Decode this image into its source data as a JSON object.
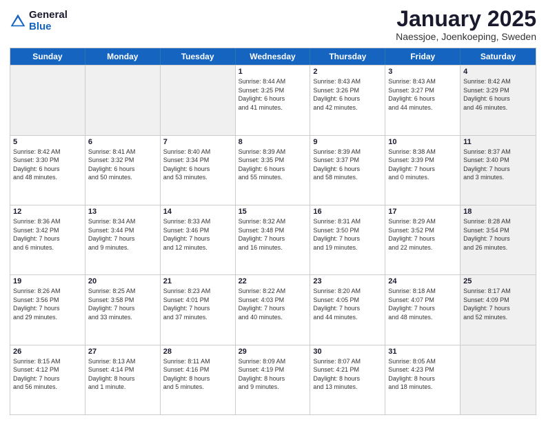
{
  "logo": {
    "general": "General",
    "blue": "Blue"
  },
  "title": "January 2025",
  "location": "Naessjoe, Joenkoeping, Sweden",
  "header_days": [
    "Sunday",
    "Monday",
    "Tuesday",
    "Wednesday",
    "Thursday",
    "Friday",
    "Saturday"
  ],
  "weeks": [
    [
      {
        "day": "",
        "info": "",
        "shaded": true
      },
      {
        "day": "",
        "info": "",
        "shaded": true
      },
      {
        "day": "",
        "info": "",
        "shaded": true
      },
      {
        "day": "1",
        "info": "Sunrise: 8:44 AM\nSunset: 3:25 PM\nDaylight: 6 hours\nand 41 minutes."
      },
      {
        "day": "2",
        "info": "Sunrise: 8:43 AM\nSunset: 3:26 PM\nDaylight: 6 hours\nand 42 minutes."
      },
      {
        "day": "3",
        "info": "Sunrise: 8:43 AM\nSunset: 3:27 PM\nDaylight: 6 hours\nand 44 minutes."
      },
      {
        "day": "4",
        "info": "Sunrise: 8:42 AM\nSunset: 3:29 PM\nDaylight: 6 hours\nand 46 minutes.",
        "shaded": true
      }
    ],
    [
      {
        "day": "5",
        "info": "Sunrise: 8:42 AM\nSunset: 3:30 PM\nDaylight: 6 hours\nand 48 minutes."
      },
      {
        "day": "6",
        "info": "Sunrise: 8:41 AM\nSunset: 3:32 PM\nDaylight: 6 hours\nand 50 minutes."
      },
      {
        "day": "7",
        "info": "Sunrise: 8:40 AM\nSunset: 3:34 PM\nDaylight: 6 hours\nand 53 minutes."
      },
      {
        "day": "8",
        "info": "Sunrise: 8:39 AM\nSunset: 3:35 PM\nDaylight: 6 hours\nand 55 minutes."
      },
      {
        "day": "9",
        "info": "Sunrise: 8:39 AM\nSunset: 3:37 PM\nDaylight: 6 hours\nand 58 minutes."
      },
      {
        "day": "10",
        "info": "Sunrise: 8:38 AM\nSunset: 3:39 PM\nDaylight: 7 hours\nand 0 minutes."
      },
      {
        "day": "11",
        "info": "Sunrise: 8:37 AM\nSunset: 3:40 PM\nDaylight: 7 hours\nand 3 minutes.",
        "shaded": true
      }
    ],
    [
      {
        "day": "12",
        "info": "Sunrise: 8:36 AM\nSunset: 3:42 PM\nDaylight: 7 hours\nand 6 minutes."
      },
      {
        "day": "13",
        "info": "Sunrise: 8:34 AM\nSunset: 3:44 PM\nDaylight: 7 hours\nand 9 minutes."
      },
      {
        "day": "14",
        "info": "Sunrise: 8:33 AM\nSunset: 3:46 PM\nDaylight: 7 hours\nand 12 minutes."
      },
      {
        "day": "15",
        "info": "Sunrise: 8:32 AM\nSunset: 3:48 PM\nDaylight: 7 hours\nand 16 minutes."
      },
      {
        "day": "16",
        "info": "Sunrise: 8:31 AM\nSunset: 3:50 PM\nDaylight: 7 hours\nand 19 minutes."
      },
      {
        "day": "17",
        "info": "Sunrise: 8:29 AM\nSunset: 3:52 PM\nDaylight: 7 hours\nand 22 minutes."
      },
      {
        "day": "18",
        "info": "Sunrise: 8:28 AM\nSunset: 3:54 PM\nDaylight: 7 hours\nand 26 minutes.",
        "shaded": true
      }
    ],
    [
      {
        "day": "19",
        "info": "Sunrise: 8:26 AM\nSunset: 3:56 PM\nDaylight: 7 hours\nand 29 minutes."
      },
      {
        "day": "20",
        "info": "Sunrise: 8:25 AM\nSunset: 3:58 PM\nDaylight: 7 hours\nand 33 minutes."
      },
      {
        "day": "21",
        "info": "Sunrise: 8:23 AM\nSunset: 4:01 PM\nDaylight: 7 hours\nand 37 minutes."
      },
      {
        "day": "22",
        "info": "Sunrise: 8:22 AM\nSunset: 4:03 PM\nDaylight: 7 hours\nand 40 minutes."
      },
      {
        "day": "23",
        "info": "Sunrise: 8:20 AM\nSunset: 4:05 PM\nDaylight: 7 hours\nand 44 minutes."
      },
      {
        "day": "24",
        "info": "Sunrise: 8:18 AM\nSunset: 4:07 PM\nDaylight: 7 hours\nand 48 minutes."
      },
      {
        "day": "25",
        "info": "Sunrise: 8:17 AM\nSunset: 4:09 PM\nDaylight: 7 hours\nand 52 minutes.",
        "shaded": true
      }
    ],
    [
      {
        "day": "26",
        "info": "Sunrise: 8:15 AM\nSunset: 4:12 PM\nDaylight: 7 hours\nand 56 minutes."
      },
      {
        "day": "27",
        "info": "Sunrise: 8:13 AM\nSunset: 4:14 PM\nDaylight: 8 hours\nand 1 minute."
      },
      {
        "day": "28",
        "info": "Sunrise: 8:11 AM\nSunset: 4:16 PM\nDaylight: 8 hours\nand 5 minutes."
      },
      {
        "day": "29",
        "info": "Sunrise: 8:09 AM\nSunset: 4:19 PM\nDaylight: 8 hours\nand 9 minutes."
      },
      {
        "day": "30",
        "info": "Sunrise: 8:07 AM\nSunset: 4:21 PM\nDaylight: 8 hours\nand 13 minutes."
      },
      {
        "day": "31",
        "info": "Sunrise: 8:05 AM\nSunset: 4:23 PM\nDaylight: 8 hours\nand 18 minutes."
      },
      {
        "day": "",
        "info": "",
        "shaded": true
      }
    ]
  ]
}
